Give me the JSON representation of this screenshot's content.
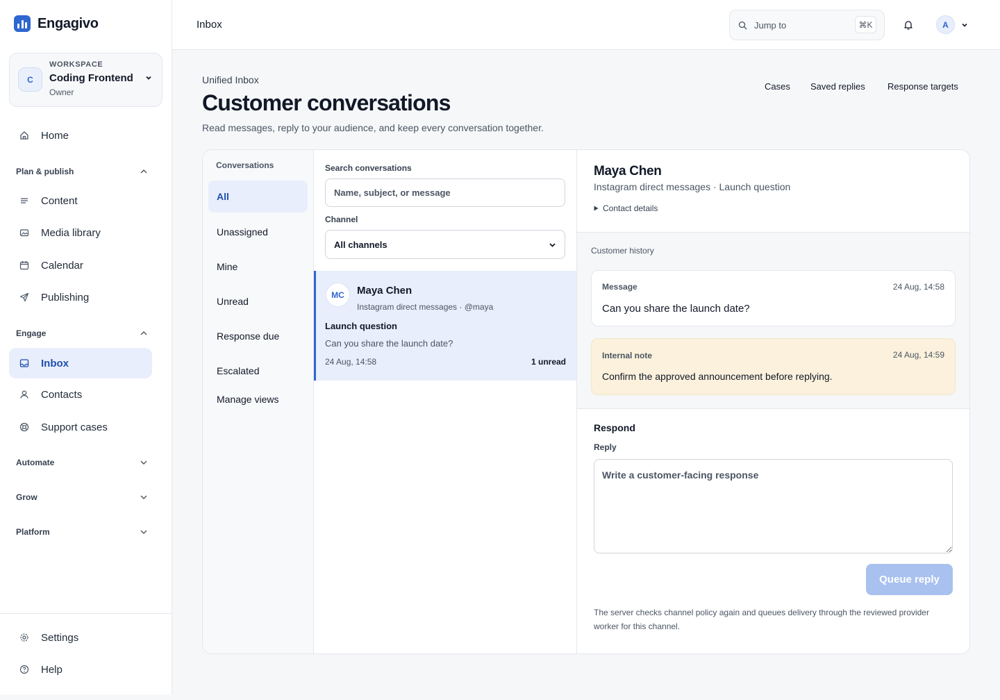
{
  "brand": {
    "name": "Engagivo"
  },
  "workspace": {
    "kicker": "WORKSPACE",
    "initial": "C",
    "name": "Coding Frontend",
    "role": "Owner"
  },
  "sidebar": {
    "home": "Home",
    "groups": {
      "plan": "Plan & publish",
      "engage": "Engage",
      "automate": "Automate",
      "grow": "Grow",
      "platform": "Platform"
    },
    "plan_items": [
      "Content",
      "Media library",
      "Calendar",
      "Publishing"
    ],
    "engage_items": [
      "Inbox",
      "Contacts",
      "Support cases"
    ],
    "footer": [
      "Settings",
      "Help"
    ]
  },
  "topbar": {
    "title": "Inbox",
    "search_placeholder": "Jump to",
    "shortcut": "⌘K",
    "avatar": "A"
  },
  "header": {
    "kicker": "Unified Inbox",
    "title": "Customer conversations",
    "description": "Read messages, reply to your audience, and keep every conversation together.",
    "links": [
      "Cases",
      "Saved replies",
      "Response targets"
    ]
  },
  "views": {
    "heading": "Conversations",
    "items": [
      "All",
      "Unassigned",
      "Mine",
      "Unread",
      "Response due",
      "Escalated"
    ],
    "manage": "Manage views"
  },
  "list": {
    "search_label": "Search conversations",
    "search_placeholder": "Name, subject, or message",
    "channel_label": "Channel",
    "channel_value": "All channels",
    "conversations": [
      {
        "initials": "MC",
        "name": "Maya Chen",
        "channel": "Instagram direct messages · @maya",
        "subject": "Launch question",
        "preview": "Can you share the launch date?",
        "time": "24 Aug, 14:58",
        "unread": "1 unread"
      }
    ]
  },
  "detail": {
    "name": "Maya Chen",
    "subtitle": "Instagram direct messages · Launch question",
    "contact_toggle": "Contact details",
    "history_heading": "Customer history",
    "history": [
      {
        "kind": "Message",
        "time": "24 Aug, 14:58",
        "body": "Can you share the launch date?"
      },
      {
        "kind": "Internal note",
        "time": "24 Aug, 14:59",
        "body": "Confirm the approved announcement before replying."
      }
    ],
    "respond_title": "Respond",
    "reply_label": "Reply",
    "reply_placeholder": "Write a customer-facing response",
    "queue_button": "Queue reply",
    "disclaimer": "The server checks channel policy again and queues delivery through the reviewed provider worker for this channel."
  },
  "colors": {
    "accent": "#2f66d0",
    "active_bg": "#e8eefb",
    "note_bg": "#fbf1dc",
    "button_disabled": "#a9c1ef"
  }
}
